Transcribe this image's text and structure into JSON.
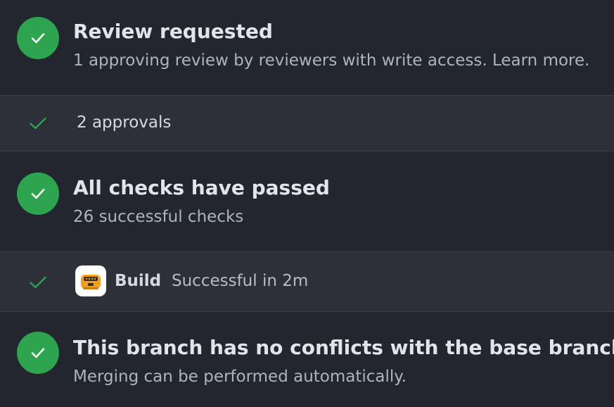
{
  "review": {
    "title": "Review requested",
    "subtitle": "1 approving review by reviewers with write access. Learn more.",
    "approvals_label": "2 approvals"
  },
  "checks": {
    "title": "All checks have passed",
    "subtitle": "26 successful checks",
    "build_name": "Build",
    "build_status": "Successful in 2m"
  },
  "merge": {
    "title": "This branch has no conflicts with the base branch",
    "subtitle": "Merging can be performed automatically."
  },
  "colors": {
    "background": "#22262e",
    "row_background": "#2c3039",
    "success_green": "#2ea44f",
    "title_text": "#e1e4e8",
    "muted_text": "#aeb4bd"
  },
  "icons": {
    "status": "check-circle-icon",
    "row": "check-icon",
    "app": "build-app-icon"
  }
}
